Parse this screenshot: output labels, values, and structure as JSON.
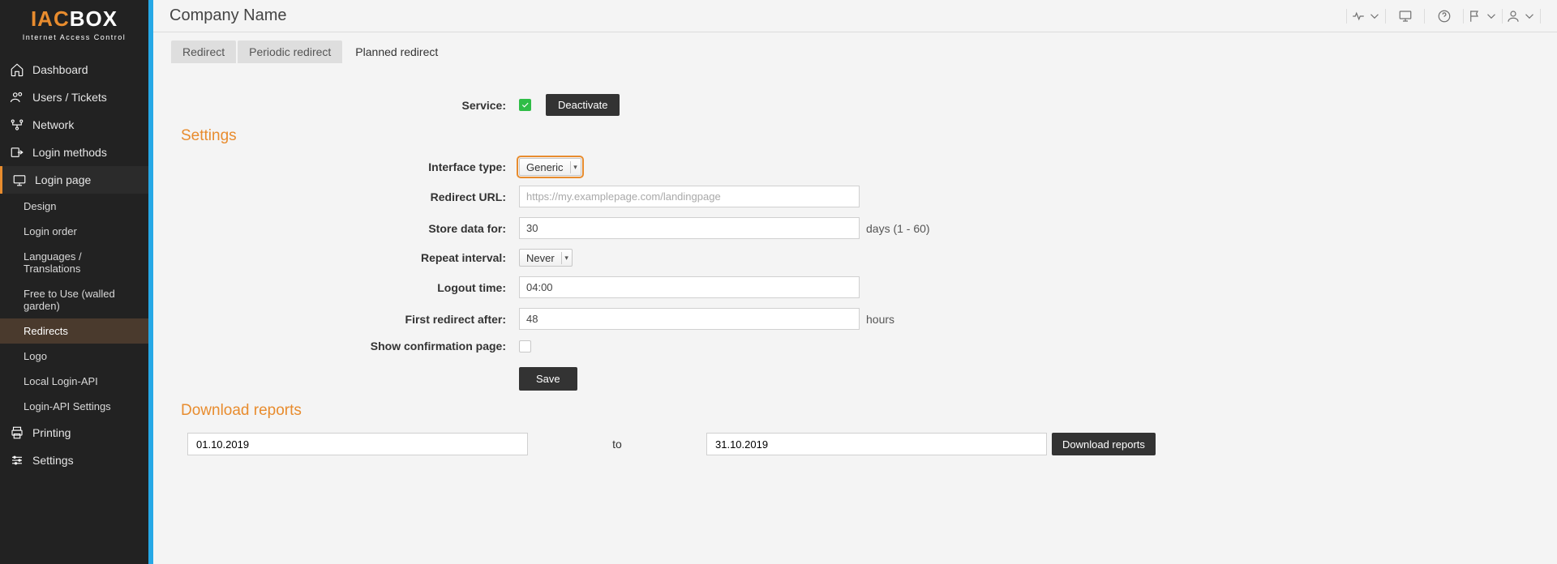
{
  "brand": {
    "line1a": "IAC",
    "line1b": "BOX",
    "line2": "Internet Access Control"
  },
  "sidebar": {
    "items": [
      {
        "label": "Dashboard"
      },
      {
        "label": "Users / Tickets"
      },
      {
        "label": "Network"
      },
      {
        "label": "Login methods"
      },
      {
        "label": "Login page"
      },
      {
        "label": "Printing"
      },
      {
        "label": "Settings"
      }
    ],
    "sub": [
      {
        "label": "Design"
      },
      {
        "label": "Login order"
      },
      {
        "label": "Languages / Translations"
      },
      {
        "label": "Free to Use (walled garden)"
      },
      {
        "label": "Redirects"
      },
      {
        "label": "Logo"
      },
      {
        "label": "Local Login-API"
      },
      {
        "label": "Login-API Settings"
      }
    ]
  },
  "header": {
    "title": "Company Name"
  },
  "tabs": [
    {
      "label": "Redirect"
    },
    {
      "label": "Periodic redirect"
    },
    {
      "label": "Planned redirect"
    }
  ],
  "form": {
    "service_label": "Service:",
    "deactivate": "Deactivate",
    "settings_heading": "Settings",
    "interface_type_label": "Interface type:",
    "interface_type_value": "Generic",
    "redirect_url_label": "Redirect URL:",
    "redirect_url_placeholder": "https://my.examplepage.com/landingpage",
    "store_label": "Store data for:",
    "store_value": "30",
    "store_hint": "days (1 - 60)",
    "repeat_label": "Repeat interval:",
    "repeat_value": "Never",
    "logout_label": "Logout time:",
    "logout_value": "04:00",
    "first_label": "First redirect after:",
    "first_value": "48",
    "first_hint": "hours",
    "confirm_label": "Show confirmation page:",
    "save": "Save"
  },
  "reports": {
    "heading": "Download reports",
    "from": "01.10.2019",
    "to_label": "to",
    "to": "31.10.2019",
    "download": "Download reports"
  }
}
